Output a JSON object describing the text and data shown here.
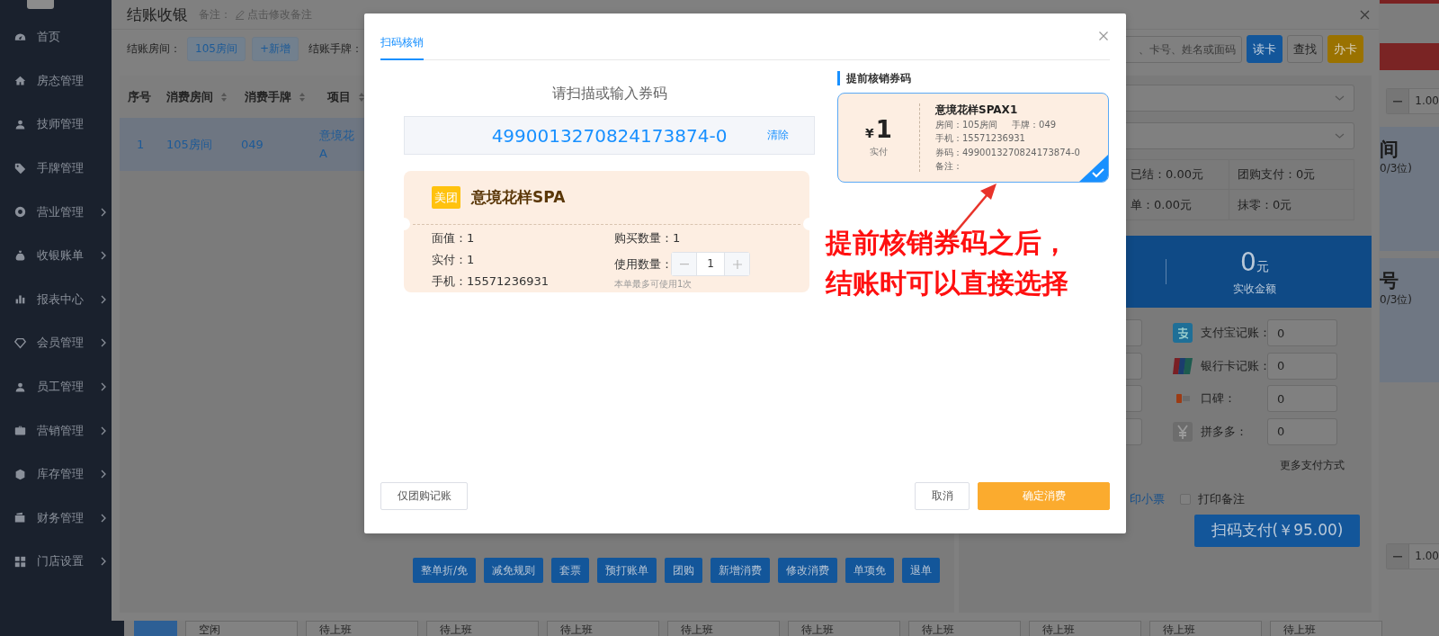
{
  "sidebar": {
    "items": [
      {
        "label": "首页",
        "kind": "gauge",
        "has_submenu": false
      },
      {
        "label": "房态管理",
        "kind": "home",
        "has_submenu": false
      },
      {
        "label": "技师管理",
        "kind": "user",
        "has_submenu": false
      },
      {
        "label": "手牌管理",
        "kind": "tag",
        "has_submenu": false
      },
      {
        "label": "营业管理",
        "kind": "lifebuoy",
        "has_submenu": true
      },
      {
        "label": "收银账单",
        "kind": "moneybag",
        "has_submenu": true
      },
      {
        "label": "报表中心",
        "kind": "bar-chart",
        "has_submenu": true
      },
      {
        "label": "会员管理",
        "kind": "diamond",
        "has_submenu": true
      },
      {
        "label": "员工管理",
        "kind": "user",
        "has_submenu": true
      },
      {
        "label": "营销管理",
        "kind": "briefcase",
        "has_submenu": true
      },
      {
        "label": "库存管理",
        "kind": "cube",
        "has_submenu": true
      },
      {
        "label": "财务管理",
        "kind": "wallet",
        "has_submenu": true
      },
      {
        "label": "门店设置",
        "kind": "grid",
        "has_submenu": true
      }
    ]
  },
  "checkout": {
    "title": "结账收银",
    "note_label": "备注：",
    "note_link": "点击修改备注",
    "room_label": "结账房间：",
    "room_tag": "105房间",
    "add_button": "+新增",
    "tag_label": "结账手牌：",
    "search": {
      "placeholder": "、卡号、姓名或面码"
    },
    "search_buttons": [
      {
        "label": "读卡",
        "kind": "primary"
      },
      {
        "label": "查找",
        "kind": "plain"
      },
      {
        "label": "办卡",
        "kind": "warning"
      }
    ],
    "table": {
      "columns": [
        {
          "label": "序号",
          "sortable": false
        },
        {
          "label": "消费房间",
          "sortable": true
        },
        {
          "label": "消费手牌",
          "sortable": true
        },
        {
          "label": "项目",
          "sortable": true
        }
      ],
      "rows": [
        {
          "index": "1",
          "room": "105房间",
          "tag": "049",
          "item": [
            "意境花",
            "A"
          ],
          "selected": true
        }
      ]
    },
    "actions": [
      "整单折/免",
      "减免规则",
      "套票",
      "预打账单",
      "团购",
      "新增消费",
      "修改消费",
      "单项免",
      "退单"
    ],
    "summary": [
      "已结：0.00元",
      "团购支付：0元",
      "单：0.00元",
      "抹零：0元"
    ],
    "total": {
      "amount": "0",
      "unit": "元",
      "label": "实收金额"
    },
    "payments": [
      {
        "kind": "alipay",
        "label": "支付宝记账：",
        "value": "0"
      },
      {
        "kind": "unionpay",
        "label": "银行卡记账：",
        "value": "0"
      },
      {
        "kind": "koubei",
        "label": "口碑：",
        "value": "0"
      },
      {
        "kind": "yuan",
        "label": "拼多多：",
        "value": "0"
      }
    ],
    "more_payments": "更多支付方式",
    "print_receipt": "印小票",
    "print_note": {
      "label": "打印备注",
      "checked": false
    },
    "pay_button": "扫码支付(￥95.00)"
  },
  "background": {
    "steppers": [
      "1.00",
      "1.00"
    ],
    "rooms": [
      {
        "name": "间",
        "capacity": "0/3位)"
      },
      {
        "name": "号",
        "capacity": "0/3位)"
      }
    ],
    "status_cards": [
      "空闲",
      "待上班",
      "待上班",
      "待上班",
      "待上班",
      "待上班",
      "待上班",
      "待上班",
      "待上班",
      "待上班"
    ]
  },
  "modal": {
    "tabs": [
      {
        "label": "扫码核销",
        "selected": true
      }
    ],
    "prompt": "请扫描或输入券码",
    "code": "4990013270824173874-0",
    "clear": "清除",
    "coupon": {
      "platform": "美团",
      "name": "意境花样SPA",
      "face_value": "面值：1",
      "paid": "实付：1",
      "phone": "手机：15571236931",
      "bought": "购买数量：1",
      "use_label": "使用数量：",
      "quantity": "1",
      "hint": "本单最多可使用1次"
    },
    "prepaid_title": "提前核销券码",
    "prepaid": [
      {
        "currency": "¥",
        "amount": "1",
        "amount_label": "实付",
        "title": "意境花样SPAX1",
        "room": "房间：105房间",
        "tag": "手牌：049",
        "phone": "手机：15571236931",
        "code": "券码：4990013270824173874-0",
        "note": "备注：",
        "selected": true
      }
    ],
    "annotation": [
      "提前核销券码之后，",
      "结账时可以直接选择"
    ],
    "footer": {
      "record_only": "仅团购记账",
      "cancel": "取消",
      "confirm": "确定消费"
    }
  }
}
